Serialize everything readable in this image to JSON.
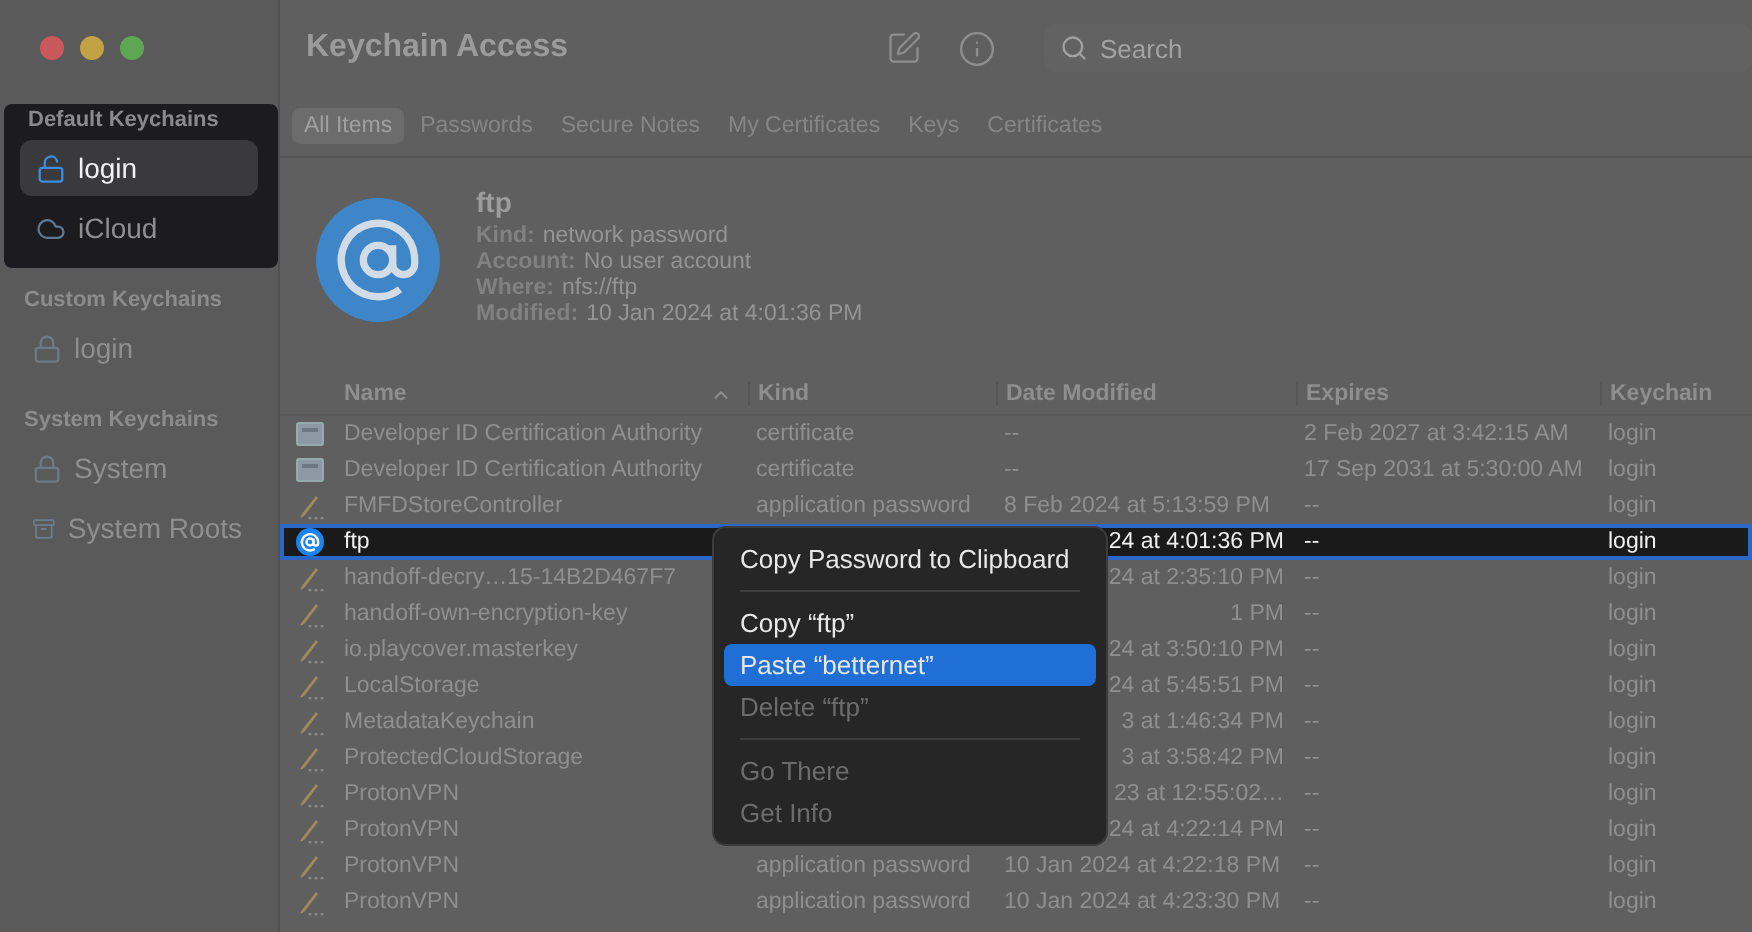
{
  "window": {
    "title": "Keychain Access",
    "search": {
      "placeholder": "Search"
    }
  },
  "sidebar": [
    {
      "heading": "Default Keychains",
      "highlighted": true,
      "items": [
        {
          "label": "login",
          "selected": true
        },
        {
          "label": "iCloud",
          "selected": false
        }
      ]
    },
    {
      "heading": "Custom Keychains",
      "highlighted": false,
      "items": [
        {
          "label": "login",
          "selected": false
        }
      ]
    },
    {
      "heading": "System Keychains",
      "highlighted": false,
      "items": [
        {
          "label": "System",
          "selected": false
        },
        {
          "label": "System Roots",
          "selected": false
        }
      ]
    }
  ],
  "tabs": [
    {
      "label": "All Items",
      "selected": true
    },
    {
      "label": "Passwords",
      "selected": false
    },
    {
      "label": "Secure Notes",
      "selected": false
    },
    {
      "label": "My Certificates",
      "selected": false
    },
    {
      "label": "Keys",
      "selected": false
    },
    {
      "label": "Certificates",
      "selected": false
    }
  ],
  "detail": {
    "name": "ftp",
    "fields": [
      {
        "label": "Kind:",
        "value": "network password"
      },
      {
        "label": "Account:",
        "value": "No user account"
      },
      {
        "label": "Where:",
        "value": "nfs://ftp"
      },
      {
        "label": "Modified:",
        "value": "10 Jan 2024 at 4:01:36 PM"
      }
    ]
  },
  "table": {
    "columns": [
      "Name",
      "Kind",
      "Date Modified",
      "Expires",
      "Keychain"
    ],
    "rows": [
      {
        "kind": "certificate",
        "name": "Developer ID Certification Authority",
        "type": "certificate",
        "date": "--",
        "expires": "2 Feb 2027 at 3:42:15 AM",
        "keychain": "login",
        "selected": false,
        "date_cut": false
      },
      {
        "kind": "certificate",
        "name": "Developer ID Certification Authority",
        "type": "certificate",
        "date": "--",
        "expires": "17 Sep 2031 at 5:30:00 AM",
        "keychain": "login",
        "selected": false,
        "date_cut": false
      },
      {
        "kind": "key",
        "name": "FMFDStoreController",
        "type": "application password",
        "date": "8 Feb 2024 at 5:13:59 PM",
        "expires": "--",
        "keychain": "login",
        "selected": false,
        "date_cut": false
      },
      {
        "kind": "network",
        "name": "ftp",
        "date": "24 at 4:01:36 PM",
        "expires": "--",
        "keychain": "login",
        "selected": true,
        "date_cut": true
      },
      {
        "kind": "key",
        "name": "handoff-decry…15-14B2D467F7",
        "date": "24 at 2:35:10 PM",
        "expires": "--",
        "keychain": "login",
        "selected": false,
        "date_cut": true
      },
      {
        "kind": "key",
        "name": "handoff-own-encryption-key",
        "date": "1 PM",
        "expires": "--",
        "keychain": "login",
        "selected": false,
        "date_cut": true
      },
      {
        "kind": "key",
        "name": "io.playcover.masterkey",
        "date": "24 at 3:50:10 PM",
        "expires": "--",
        "keychain": "login",
        "selected": false,
        "date_cut": true
      },
      {
        "kind": "key",
        "name": "LocalStorage",
        "date": "24 at 5:45:51 PM",
        "expires": "--",
        "keychain": "login",
        "selected": false,
        "date_cut": true
      },
      {
        "kind": "key",
        "name": "MetadataKeychain",
        "date": "3 at 1:46:34 PM",
        "expires": "--",
        "keychain": "login",
        "selected": false,
        "date_cut": true
      },
      {
        "kind": "key",
        "name": "ProtectedCloudStorage",
        "date": "3 at 3:58:42 PM",
        "expires": "--",
        "keychain": "login",
        "selected": false,
        "date_cut": true
      },
      {
        "kind": "key",
        "name": "ProtonVPN",
        "date": "23 at 12:55:02…",
        "expires": "--",
        "keychain": "login",
        "selected": false,
        "date_cut": true
      },
      {
        "kind": "key",
        "name": "ProtonVPN",
        "date": "24 at 4:22:14 PM",
        "expires": "--",
        "keychain": "login",
        "selected": false,
        "date_cut": true
      },
      {
        "kind": "key",
        "name": "ProtonVPN",
        "type": "application password",
        "date": "10 Jan 2024 at 4:22:18 PM",
        "expires": "--",
        "keychain": "login",
        "selected": false,
        "date_cut": false
      },
      {
        "kind": "key",
        "name": "ProtonVPN",
        "type": "application password",
        "date": "10 Jan 2024 at 4:23:30 PM",
        "expires": "--",
        "keychain": "login",
        "selected": false,
        "date_cut": false
      }
    ]
  },
  "context_menu": [
    {
      "kind": "item",
      "label": "Copy Password to Clipboard",
      "selected": false,
      "disabled": false
    },
    {
      "kind": "separator"
    },
    {
      "kind": "item",
      "label": "Copy “ftp”",
      "selected": false,
      "disabled": false
    },
    {
      "kind": "item",
      "label": "Paste “betternet”",
      "selected": true,
      "disabled": false
    },
    {
      "kind": "item",
      "label": "Delete “ftp”",
      "selected": false,
      "disabled": true
    },
    {
      "kind": "separator"
    },
    {
      "kind": "item",
      "label": "Go There",
      "selected": false,
      "disabled": true
    },
    {
      "kind": "item",
      "label": "Get Info",
      "selected": false,
      "disabled": true
    }
  ]
}
